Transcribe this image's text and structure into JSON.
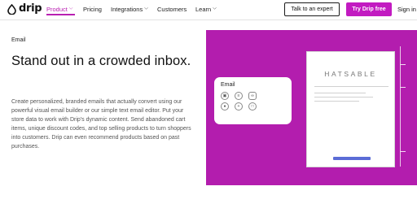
{
  "header": {
    "logo_text": "drip",
    "nav": [
      {
        "label": "Product",
        "dropdown": true,
        "active": true
      },
      {
        "label": "Pricing",
        "dropdown": false,
        "active": false
      },
      {
        "label": "Integrations",
        "dropdown": true,
        "active": false
      },
      {
        "label": "Customers",
        "dropdown": false,
        "active": false
      },
      {
        "label": "Learn",
        "dropdown": true,
        "active": false
      }
    ],
    "talk_button": "Talk to an expert",
    "try_button": "Try Drip free",
    "sign_in": "Sign in"
  },
  "main": {
    "eyebrow": "Email",
    "headline": "Stand out in a crowded inbox.",
    "body": "Create personalized, branded emails that actually convert using our powerful visual email builder or our simple text email editor. Put your store data to work with Drip's dynamic content. Send abandoned cart items, unique discount codes, and top selling products to turn shoppers into customers. Drip can even recommend products based on past purchases."
  },
  "illustration": {
    "card_title": "Email",
    "email_preview_brand": "HATSABLE",
    "icons": [
      "image-icon",
      "text-icon",
      "link-icon",
      "divider-icon",
      "plus-icon",
      "product-icon"
    ]
  },
  "colors": {
    "brand_magenta": "#c21bc1",
    "hero_bg": "#b31dae",
    "cta_blue": "#5b6cd6"
  }
}
